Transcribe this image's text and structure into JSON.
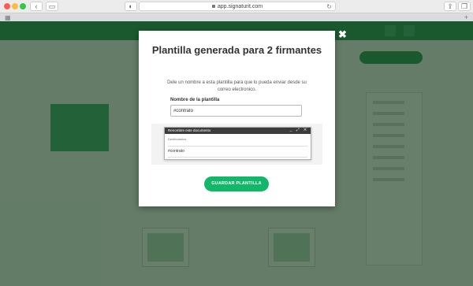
{
  "browser": {
    "url": "app.signaturit.com",
    "back_icon": "chevron-left-icon",
    "forward_icon": "chevron-right-icon"
  },
  "modal": {
    "title": "Plantilla generada para 2 firmantes",
    "description": "Dele un nombre a esta plantilla para que lo pueda enviar desde su correo electronico.",
    "field_label": "Nombre de la plantilla",
    "field_value": "#contrato",
    "save_label": "GUARDAR PLANTILLA",
    "close_icon": "close-icon",
    "rename_dialog": {
      "title": "Renombre este documento",
      "field_label": "Destinatarios",
      "value": "#contrato"
    }
  },
  "colors": {
    "primary_green": "#12b76a",
    "overlay": "#183c1e",
    "header_green": "#1e8f4e"
  }
}
